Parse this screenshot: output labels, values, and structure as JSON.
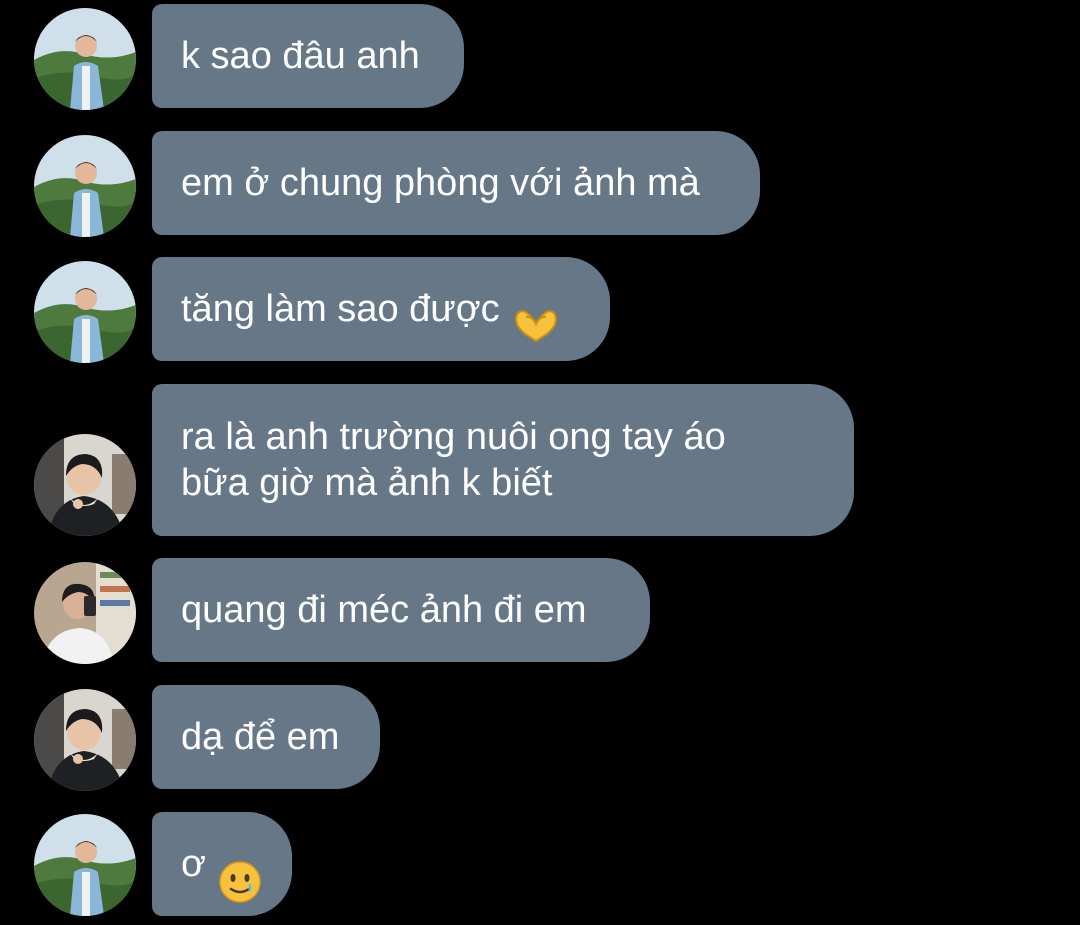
{
  "messages": [
    {
      "sender": "a",
      "text": "k sao đâu anh",
      "emoji": ""
    },
    {
      "sender": "a",
      "text": "em ở chung phòng với ảnh mà",
      "emoji": ""
    },
    {
      "sender": "a",
      "text": "tăng làm sao được",
      "emoji": "heart-hands"
    },
    {
      "sender": "b",
      "text": "ra là anh trường nuôi ong tay áo\nbữa giờ mà ảnh k biết",
      "emoji": ""
    },
    {
      "sender": "c",
      "text": "quang đi méc ảnh đi em",
      "emoji": ""
    },
    {
      "sender": "b",
      "text": "dạ để em",
      "emoji": ""
    },
    {
      "sender": "a",
      "text": "ơ",
      "emoji": "smiling-face-with-tear"
    }
  ],
  "colors": {
    "background": "#000000",
    "bubble": "#667788",
    "text": "#ffffff"
  }
}
